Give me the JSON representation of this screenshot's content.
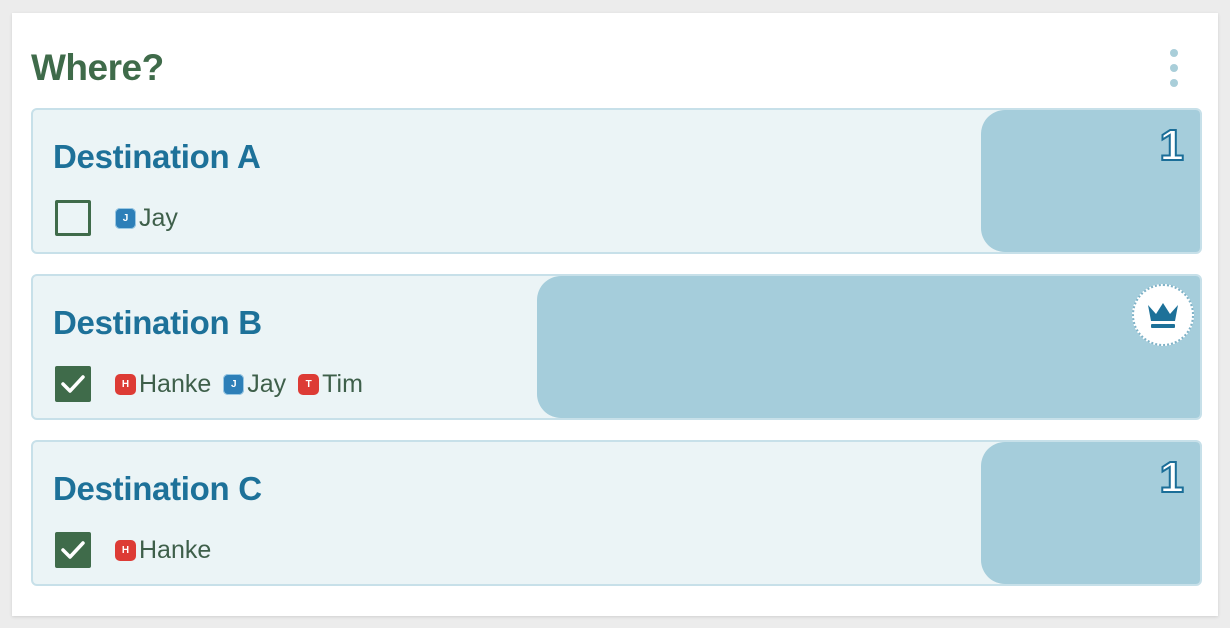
{
  "widget": {
    "title": "Where?",
    "menu_icon": "kebab-menu-icon"
  },
  "colors": {
    "title_green": "#3f6b4a",
    "option_title_blue": "#1d7199",
    "bar_blue": "#a5cddb",
    "option_bg": "#ebf4f6",
    "badge_red": "#dd3b35",
    "badge_blue": "#2d7fb8"
  },
  "options": [
    {
      "title": "Destination A",
      "checked": false,
      "vote_share": 0.1875,
      "vote_count": "1",
      "winner": false,
      "voters": [
        {
          "initial": "J",
          "name": "Jay",
          "color": "blue"
        }
      ]
    },
    {
      "title": "Destination B",
      "checked": true,
      "vote_share": 0.568,
      "vote_count": "",
      "winner": true,
      "winner_icon": "crown-icon",
      "voters": [
        {
          "initial": "H",
          "name": "Hanke",
          "color": "red"
        },
        {
          "initial": "J",
          "name": "Jay",
          "color": "blue"
        },
        {
          "initial": "T",
          "name": "Tim",
          "color": "red"
        }
      ]
    },
    {
      "title": "Destination C",
      "checked": true,
      "vote_share": 0.1875,
      "vote_count": "1",
      "winner": false,
      "voters": [
        {
          "initial": "H",
          "name": "Hanke",
          "color": "red"
        }
      ]
    }
  ]
}
